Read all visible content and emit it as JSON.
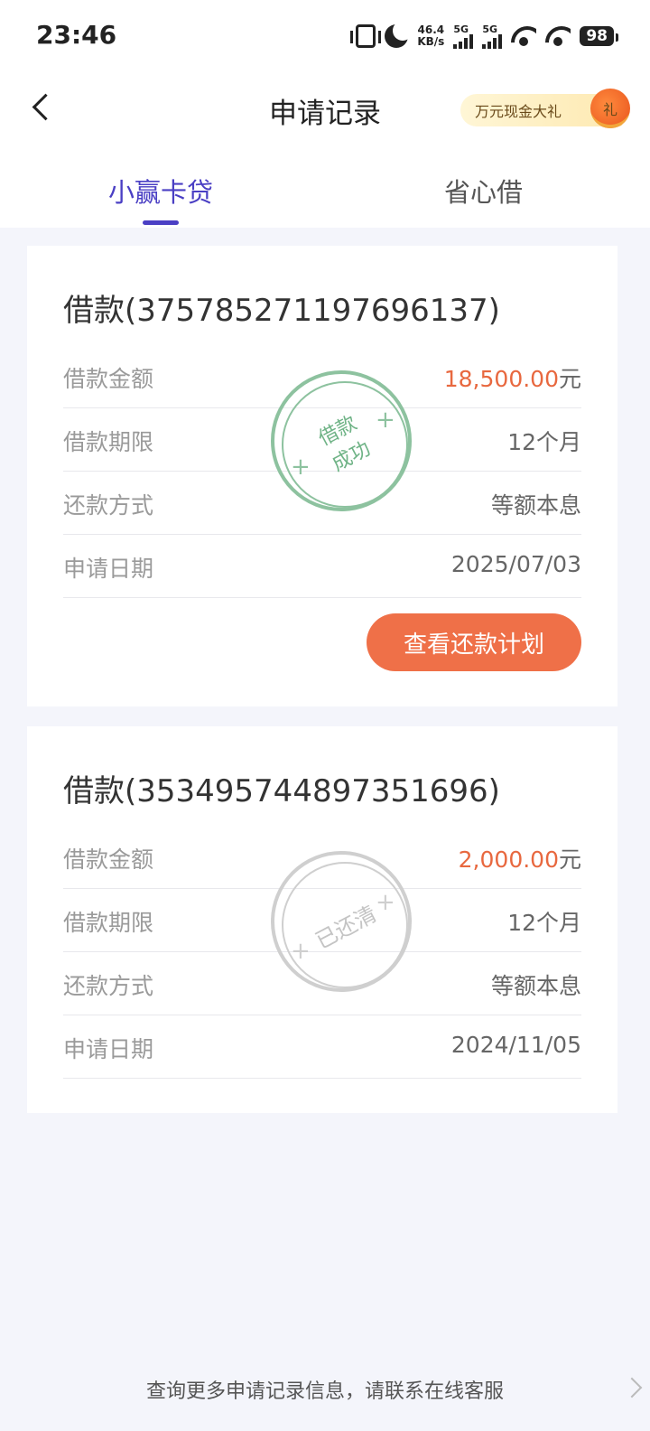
{
  "status_bar": {
    "time": "23:46",
    "speed_value": "46.4",
    "speed_unit": "KB/s",
    "signal1_tag": "5G",
    "signal2_tag": "5G",
    "battery": "98"
  },
  "header": {
    "title": "申请记录",
    "promo_label": "万元现金大礼",
    "promo_icon_text": "礼"
  },
  "tabs": [
    {
      "label": "小赢卡贷",
      "active": true
    },
    {
      "label": "省心借",
      "active": false
    }
  ],
  "cards": [
    {
      "title": "借款(3757852711976961​37)",
      "rows": [
        {
          "label": "借款金额",
          "amount": "18,500.00",
          "unit": "元"
        },
        {
          "label": "借款期限",
          "value": "12个月"
        },
        {
          "label": "还款方式",
          "value": "等额本息"
        },
        {
          "label": "申请日期",
          "value": "2025/07/03"
        }
      ],
      "stamp": {
        "line1": "借款",
        "line2": "成功"
      },
      "button_label": "查看还款计划"
    },
    {
      "title": "借款(353495744897351696)",
      "rows": [
        {
          "label": "借款金额",
          "amount": "2,000.00",
          "unit": "元"
        },
        {
          "label": "借款期限",
          "value": "12个月"
        },
        {
          "label": "还款方式",
          "value": "等额本息"
        },
        {
          "label": "申请日期",
          "value": "2024/11/05"
        }
      ],
      "stamp": {
        "line1": "已还清"
      }
    }
  ],
  "footer": {
    "text": "查询更多申请记录信息，请联系在线客服"
  },
  "colors": {
    "accent": "#4a3fc4",
    "amount": "#e8683f",
    "button": "#ef7048",
    "stamp_success": "#8dc29f",
    "stamp_paid": "#cfcfcf"
  }
}
